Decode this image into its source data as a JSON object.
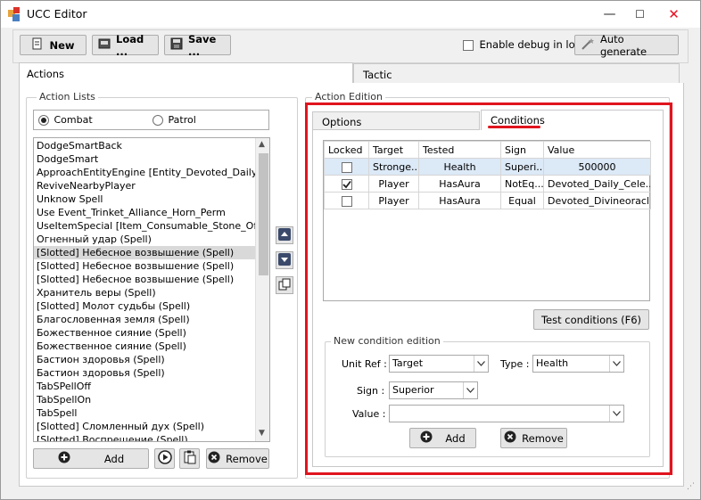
{
  "app": {
    "title": "UCC Editor"
  },
  "window_controls": {
    "minimize": "—",
    "maximize": "☐",
    "close": "✕"
  },
  "toolbar": {
    "new_label": "New",
    "load_label": "Load ...",
    "save_label": "Save ...",
    "debug_label": "Enable debug in logs",
    "auto_generate_label": "Auto generate"
  },
  "main_tabs": {
    "actions": "Actions",
    "tactic": "Tactic"
  },
  "action_lists": {
    "title": "Action Lists",
    "radio_combat": "Combat",
    "radio_patrol": "Patrol",
    "items": [
      "DodgeSmartBack",
      "DodgeSmart",
      "ApproachEntityEngine [Entity_Devoted_Daily_Cele",
      "ReviveNearbyPlayer",
      "Unknow Spell",
      "Use Event_Trinket_Alliance_Horn_Perm",
      "UseItemSpecial [Item_Consumable_Stone_Of_Hea",
      "Огненный удар (Spell)",
      "[Slotted] Небесное возвышение (Spell)",
      "[Slotted] Небесное возвышение (Spell)",
      "[Slotted] Небесное возвышение (Spell)",
      "Хранитель веры (Spell)",
      "[Slotted] Молот судьбы (Spell)",
      "Благословенная земля (Spell)",
      "Божественное сияние (Spell)",
      "Божественное сияние (Spell)",
      "Бастион здоровья (Spell)",
      "Бастион здоровья (Spell)",
      "TabSPellOff",
      "TabSpellOn",
      "TabSpell",
      "[Slotted] Сломленный дух (Spell)",
      "[Slotted] Воспрещение (Spell)"
    ],
    "selected_index": 8,
    "add_label": "Add",
    "remove_label": "Remove"
  },
  "action_edition": {
    "title": "Action Edition",
    "tab_options": "Options",
    "tab_conditions": "Conditions",
    "grid": {
      "headers": [
        "Locked",
        "Target",
        "Tested",
        "Sign",
        "Value"
      ],
      "rows": [
        {
          "locked": false,
          "target": "Stronge...",
          "tested": "Health",
          "sign": "Superi...",
          "value": "500000"
        },
        {
          "locked": true,
          "target": "Player",
          "tested": "HasAura",
          "sign": "NotEq...",
          "value": "Devoted_Daily_Cele..."
        },
        {
          "locked": false,
          "target": "Player",
          "tested": "HasAura",
          "sign": "Equal",
          "value": "Devoted_Divineoracl..."
        }
      ]
    },
    "test_conditions_label": "Test conditions (F6)",
    "new_condition": {
      "title": "New condition edition",
      "unit_ref_label": "Unit Ref :",
      "unit_ref_value": "Target",
      "type_label": "Type :",
      "type_value": "Health",
      "sign_label": "Sign :",
      "sign_value": "Superior",
      "value_label": "Value :",
      "value_value": "",
      "add_label": "Add",
      "remove_label": "Remove"
    }
  },
  "colors": {
    "highlight": "#e0141e",
    "accent_underline": "#e0141e",
    "row_selected": "#dce9f7"
  }
}
